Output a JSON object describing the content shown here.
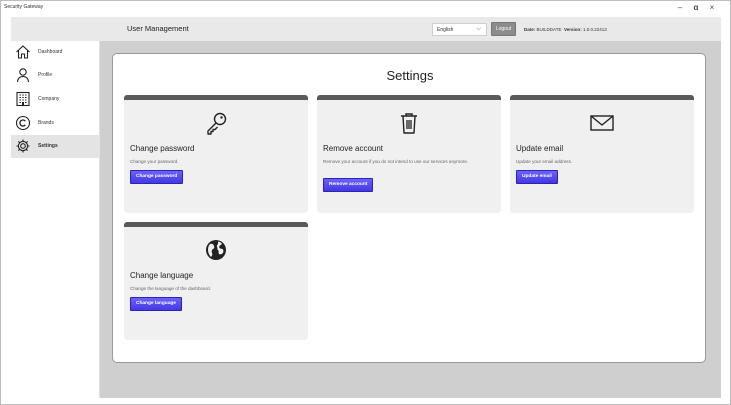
{
  "window": {
    "title": "Security Gateway",
    "minimize": "–",
    "maximize": "ɑ",
    "close": "×"
  },
  "header": {
    "title": "User Management",
    "language": "English",
    "logout_label": "Logout",
    "date_label": "Date:",
    "date_value": "BUILDDATE",
    "version_label": "Version:",
    "version_value": "1.0.0.22413"
  },
  "sidebar": {
    "items": [
      {
        "label": "Dashboard",
        "icon": "home-icon"
      },
      {
        "label": "Profile",
        "icon": "user-icon"
      },
      {
        "label": "Company",
        "icon": "building-icon"
      },
      {
        "label": "Brands",
        "icon": "copyright-icon"
      },
      {
        "label": "Settings",
        "icon": "gear-icon",
        "active": true
      }
    ]
  },
  "main": {
    "title": "Settings",
    "cards": [
      {
        "icon": "key-icon",
        "title": "Change password",
        "description": "Change your password.",
        "button": "Change password"
      },
      {
        "icon": "trash-icon",
        "title": "Remove account",
        "description": "Remove your account if you do not intend to use our services anymore.",
        "button": "Remove account"
      },
      {
        "icon": "envelope-icon",
        "title": "Update email",
        "description": "Update your email address.",
        "button": "Update email"
      },
      {
        "icon": "globe-icon",
        "title": "Change language",
        "description": "Change the language of the dashboard.",
        "button": "Change language"
      }
    ]
  },
  "colors": {
    "accent": "#4f46e5",
    "card_bar": "#5a5a5a",
    "card_bg": "#f0f0f0",
    "main_bg": "#cfcfcf"
  }
}
